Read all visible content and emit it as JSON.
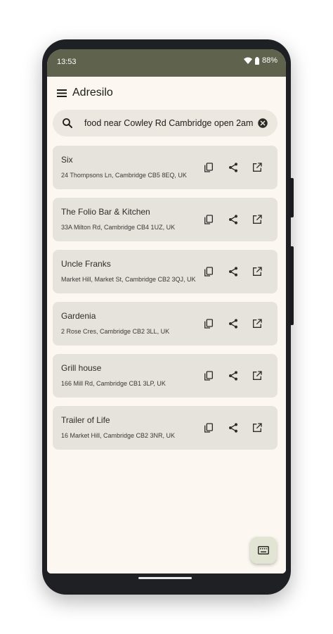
{
  "status_bar": {
    "time": "13:53",
    "battery": "88%"
  },
  "app_bar": {
    "title": "Adresilo"
  },
  "search": {
    "query": "food near Cowley Rd Cambridge open 2am"
  },
  "results": [
    {
      "name": "Six",
      "address": "24 Thompsons Ln, Cambridge CB5 8EQ, UK"
    },
    {
      "name": "The Folio Bar & Kitchen",
      "address": "33A Milton Rd, Cambridge CB4 1UZ, UK"
    },
    {
      "name": "Uncle Franks",
      "address": "Market Hill, Market St, Cambridge CB2 3QJ, UK"
    },
    {
      "name": "Gardenia",
      "address": "2 Rose Cres, Cambridge CB2 3LL, UK"
    },
    {
      "name": "Grill house",
      "address": "166 Mill Rd, Cambridge CB1 3LP, UK"
    },
    {
      "name": "Trailer of Life",
      "address": "16 Market Hill, Cambridge CB2 3NR, UK"
    }
  ],
  "icons": {
    "menu": "menu-icon",
    "search": "search-icon",
    "clear": "clear-icon",
    "copy": "copy-icon",
    "share": "share-icon",
    "open": "open-in-new-icon",
    "keyboard": "keyboard-icon"
  },
  "colors": {
    "status_bar": "#5f634e",
    "background": "#fcf8f1",
    "card": "#e6e2dc",
    "search_bar": "#ece8df",
    "fab": "#e3e5d4"
  }
}
